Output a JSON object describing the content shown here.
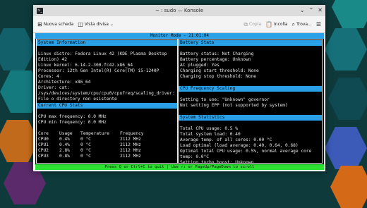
{
  "window": {
    "title": "~ : sudo — Konsole",
    "controls": {
      "minimize": "⌄",
      "maximize": "⌃",
      "close": "✕"
    }
  },
  "toolbar": {
    "new_tab": "Nuova scheda",
    "split_view": "Vista divisa",
    "copy": "Copia",
    "paste": "Incolla",
    "find": "Trova..."
  },
  "terminal": {
    "header": "Monitor Mode - 21:01:04",
    "left": {
      "system_info": {
        "title": "System Information",
        "lines": [
          "",
          "Linux distro: Fedora Linux 42 (KDE Plasma Desktop",
          "Edition) 42",
          "Linux kernel: 6.14.2-300.fc42.x86_64",
          "Processor: 12th Gen Intel(R) Core(TM) i5-1240P",
          "Cores: 4",
          "Architecture: x86_64",
          "Driver: cat:",
          "/sys/devices/system/cpu/cpu0/cpufreq/scaling_driver:",
          "File o directory non esistente"
        ]
      },
      "cpu_stats": {
        "title": "Current CPU Stats",
        "lines": [
          "",
          "CPU max frequency: 0.0 MHz",
          "CPU min frequency: 0.0 MHz",
          ""
        ],
        "columns": [
          "Core",
          "Usage",
          "Temperature",
          "Frequency"
        ],
        "rows": [
          [
            "CPU0",
            "0.4%",
            "0 °C",
            "2112 MHz"
          ],
          [
            "CPU1",
            "0.4%",
            "0 °C",
            "2112 MHz"
          ],
          [
            "CPU2",
            "2.8%",
            "0 °C",
            "2112 MHz"
          ],
          [
            "CPU3",
            "0.8%",
            "0 °C",
            "2112 MHz"
          ]
        ]
      }
    },
    "right": {
      "battery": {
        "title": "Battery Stats",
        "lines": [
          "",
          "Battery status: Not Charging",
          "Battery percentage: Unknown",
          "AC plugged: Yes",
          "Charging start threshold: None",
          "Charging stop threshold: None"
        ]
      },
      "scaling": {
        "title": "CPU Frequency Scaling",
        "lines": [
          "",
          "Setting to use: \"Unknown\" governor",
          "Not setting EPP (not supported by system)"
        ]
      },
      "statistics": {
        "title": "System Statistics",
        "lines": [
          "",
          "Total CPU usage: 0.5 %",
          "Total system load: 0.40",
          "Average temp. of all cores: 0.00 °C",
          "Load optimal (load average: 0.40, 0.64, 0.68)",
          "Optimal total CPU usage: 0.5%, normal average core",
          "temp: 0.0°C",
          "Setting turbo boost: Unknown"
        ]
      }
    },
    "footer": "Press Q or Ctrl+C to quit | Use ↑↓ or PageUp/PageDown to scroll"
  }
}
